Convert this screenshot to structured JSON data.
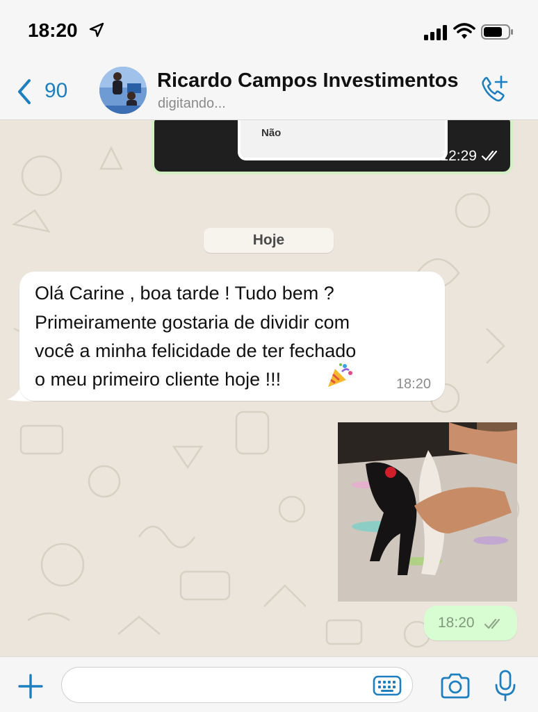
{
  "status_bar": {
    "time": "18:20",
    "location_icon": "location-arrow-icon",
    "signal_icon": "cell-signal-icon",
    "wifi_icon": "wifi-icon",
    "battery_icon": "battery-icon"
  },
  "header": {
    "back_count": "90",
    "contact_name": "Ricardo Campos Investimentos",
    "contact_status": "digitando...",
    "back_icon": "chevron-left-icon",
    "call_icon": "add-call-icon"
  },
  "chat": {
    "previous_message": {
      "poll_option": "Não",
      "time": "12:29",
      "status_icon": "double-check-icon"
    },
    "date_separator": "Hoje",
    "incoming_message": {
      "lines": [
        "Olá Carine , boa tarde ! Tudo bem ?",
        "Primeiramente gostaria de dividir com",
        "você a minha felicidade de ter fechado",
        "o meu primeiro cliente hoje !!!"
      ],
      "emoji": "party-popper-icon",
      "time": "18:20"
    },
    "outgoing_media": {
      "type": "photo",
      "time": "18:20",
      "status_icon": "double-check-icon"
    }
  },
  "input_bar": {
    "plus_icon": "plus-icon",
    "keyboard_icon": "keyboard-icon",
    "camera_icon": "camera-icon",
    "mic_icon": "microphone-icon",
    "placeholder": ""
  },
  "colors": {
    "accent": "#1e7fbf",
    "outgoing_bubble": "#d9fdd3",
    "chat_background": "#ece5dc"
  }
}
